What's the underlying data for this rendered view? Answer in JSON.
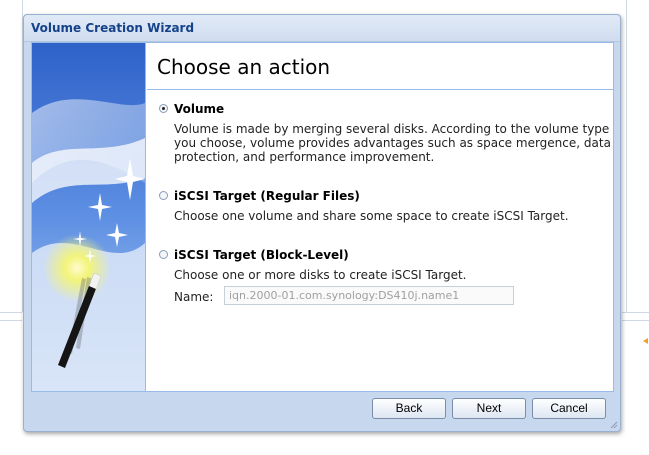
{
  "window": {
    "title": "Volume Creation Wizard"
  },
  "page": {
    "heading": "Choose an action"
  },
  "options": [
    {
      "label": "Volume",
      "description": "Volume is made by merging several disks. According to the volume type you choose, volume provides advantages such as space mergence, data protection, and performance improvement.",
      "selected": true
    },
    {
      "label": "iSCSI Target (Regular Files)",
      "description": "Choose one volume and share some space to create iSCSI Target.",
      "selected": false
    },
    {
      "label": "iSCSI Target (Block-Level)",
      "description": "Choose one or more disks to create iSCSI Target.",
      "selected": false
    }
  ],
  "name_field": {
    "label": "Name:",
    "placeholder": "iqn.2000-01.com.synology:DS410j.name1"
  },
  "buttons": {
    "back": "Back",
    "next": "Next",
    "cancel": "Cancel"
  },
  "icons": {
    "wizard_art": "magic-wand-icon",
    "resize": "resize-grip-icon"
  },
  "colors": {
    "title_text": "#15428b",
    "panel_border": "#99bbe8",
    "window_bg": "#c6d7ee"
  }
}
